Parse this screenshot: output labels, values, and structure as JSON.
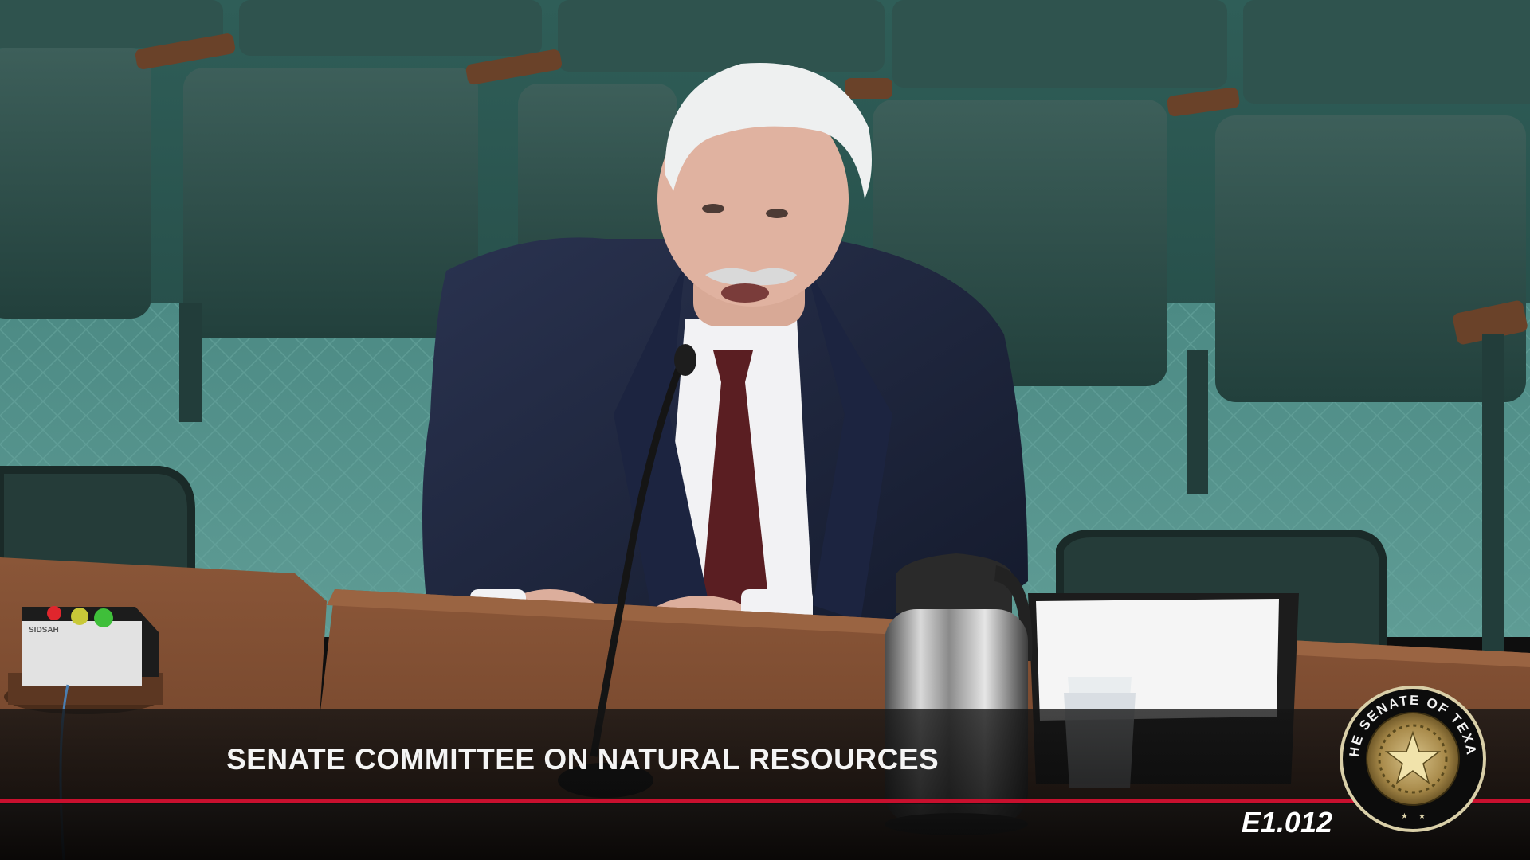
{
  "broadcast": {
    "caption": "SENATE COMMITTEE ON NATURAL RESOURCES",
    "room_code": "E1.012",
    "seal_text": "THE SENATE OF TEXAS",
    "accent_color": "#c8102e",
    "caption_color": "#f4f4f4"
  },
  "scene": {
    "subject": "witness-speaking-at-microphone",
    "objects": [
      "auditorium-seats",
      "wooden-table",
      "microphone",
      "thermal-carafe",
      "paper-stack",
      "plastic-cups",
      "speaker-timer-light"
    ],
    "timer_lights": [
      "red",
      "yellow",
      "green"
    ],
    "timer_label": "SIDSAH"
  }
}
